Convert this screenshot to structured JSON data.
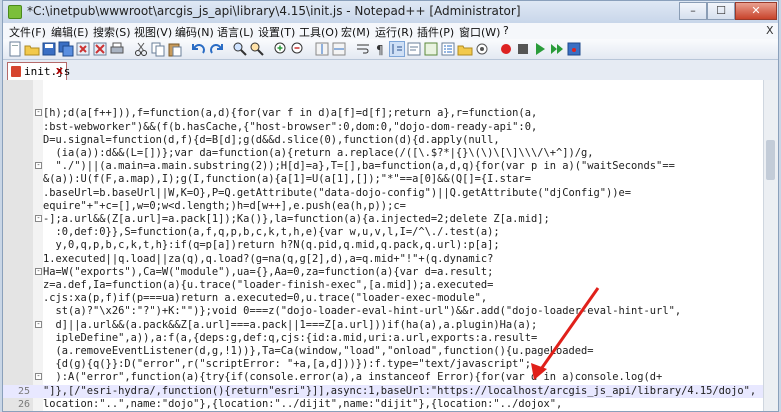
{
  "window": {
    "title": "*C:\\inetpub\\wwwroot\\arcgis_js_api\\library\\4.15\\init.js - Notepad++ [Administrator]",
    "minimize": "–",
    "maximize": "☐",
    "close": "✕"
  },
  "menu": [
    "文件(F)",
    "编辑(E)",
    "搜索(S)",
    "视图(V)",
    "编码(N)",
    "语言(L)",
    "设置(T)",
    "工具(O)",
    "宏(M)",
    "运行(R)",
    "插件(P)",
    "窗口(W)",
    "?"
  ],
  "menu_close": "X",
  "tab": {
    "label": "init.js",
    "close": "x"
  },
  "lines": [
    {
      "n": "",
      "text": ""
    },
    {
      "n": "",
      "text": ""
    },
    {
      "n": "",
      "text": "[h);d(a[f++])),f=function(a,d){for(var f in d)a[f]=d[f];return a},r=function(a,"
    },
    {
      "n": "",
      "text": ":bst-webworker\")&&(f(b.hasCache,{\"host-browser\":0,dom:0,\"dojo-dom-ready-api\":0,"
    },
    {
      "n": "",
      "text": "D=u.signal=function(d,f){d=B[d];g(d&&d.slice(0),function(d){d.apply(null,"
    },
    {
      "n": "",
      "text": "  (ia(a)):d&&(L=[])};var da=function(a){return a.replace(/([\\.$?*|{}\\(\\)\\[\\]\\\\\\/\\+^])/g,"
    },
    {
      "n": "",
      "text": "  \"./\")||(a.main=a.main.substring(2));H[d]=a},T=[],ba=function(a,d,q){for(var p in a)(\"waitSeconds\"=="
    },
    {
      "n": "",
      "text": "&(a)):U(f(F,a.map),I);g(I,function(a){a[1]=U(a[1],[]);\"*\"==a[0]&&(Q[]={I.star="
    },
    {
      "n": "",
      "text": ".baseUrl=b.baseUrl||W,K=O},P=Q.getAttribute(\"data-dojo-config\")||Q.getAttribute(\"djConfig\"))e="
    },
    {
      "n": "",
      "text": "equire\"+\"+c=[],w=0;w<d.length;)h=d[w++],e.push(ea(h,p));c="
    },
    {
      "n": "",
      "text": "-];a.url&&(Z[a.url]=a.pack[1]);Ka()},la=function(a){a.injected=2;delete Z[a.mid];"
    },
    {
      "n": "",
      "text": "  :0,def:0}},S=function(a,f,q,p,b,c,k,t,h,e){var w,u,v,l,I=/^\\./.test(a);"
    },
    {
      "n": "",
      "text": "  y,0,q,p,b,c,k,t,h}:if(q=p[a])return h?N(q.pid,q.mid,q.pack,q.url):p[a];"
    },
    {
      "n": "",
      "text": "1.executed||q.load||za(q),q.load?(g=na(q,g[2],d),a=q.mid+\"!\"+(q.dynamic?"
    },
    {
      "n": "",
      "text": "Ha=W(\"exports\"),Ca=W(\"module\"),ua={},Aa=0,za=function(a){var d=a.result;"
    },
    {
      "n": "",
      "text": "z=a.def,Ia=function(a){u.trace(\"loader-finish-exec\",[a.mid]);a.executed="
    },
    {
      "n": "",
      "text": ".cjs:xa(p,f)if(p===ua)return a.executed=0,u.trace(\"loader-exec-module\","
    },
    {
      "n": "",
      "text": "  st(a)?\"\\x26\":\"?\")+K:\"\")};void 0===z(\"dojo-loader-eval-hint-url\")&&r.add(\"dojo-loader-eval-hint-url\","
    },
    {
      "n": "",
      "text": "  d]||a.url&&(a.pack&&Z[a.url]===a.pack||1===Z[a.url]))if(ha(a),a.plugin)Ha(a);"
    },
    {
      "n": "",
      "text": "  ipleDefine\",a)),a:f(a,{deps:g,def:q,cjs:{id:a.mid,uri:a.url,exports:a.result="
    },
    {
      "n": "",
      "text": "  (a.removeEventListener(d,g,!1))},Ta=Ca(window,\"load\",\"onload\",function(){u.pageLoaded="
    },
    {
      "n": "",
      "text": "  {d(g){q(}}:D(\"error\",r(\"scriptError: \"+a,[a,d]))}):f.type=\"text/javascript\";"
    },
    {
      "n": "",
      "text": "  ):A(\"error\",function(a){try{if(console.error(a),a instanceof Error){for(var d in a)console.log(d+"
    },
    {
      "n": "25",
      "text": "\"]},[/\"esri-hydra/,function(){return\"esri\"}]],async:1,baseUrl:\"https://localhost/arcgis_js_api/library/4.15/dojo\","
    },
    {
      "n": "26",
      "text": "location:\"..\",name:\"dojo\"},{location:\"../dijit\",name:\"dijit\"},{location:\"../dojox\","
    },
    {
      "n": "27",
      "text": "  tersection-observer\"},{location:\"../maquette-css-transitions\",main:\"dist/maquette-css-transitions.umd\","
    }
  ]
}
